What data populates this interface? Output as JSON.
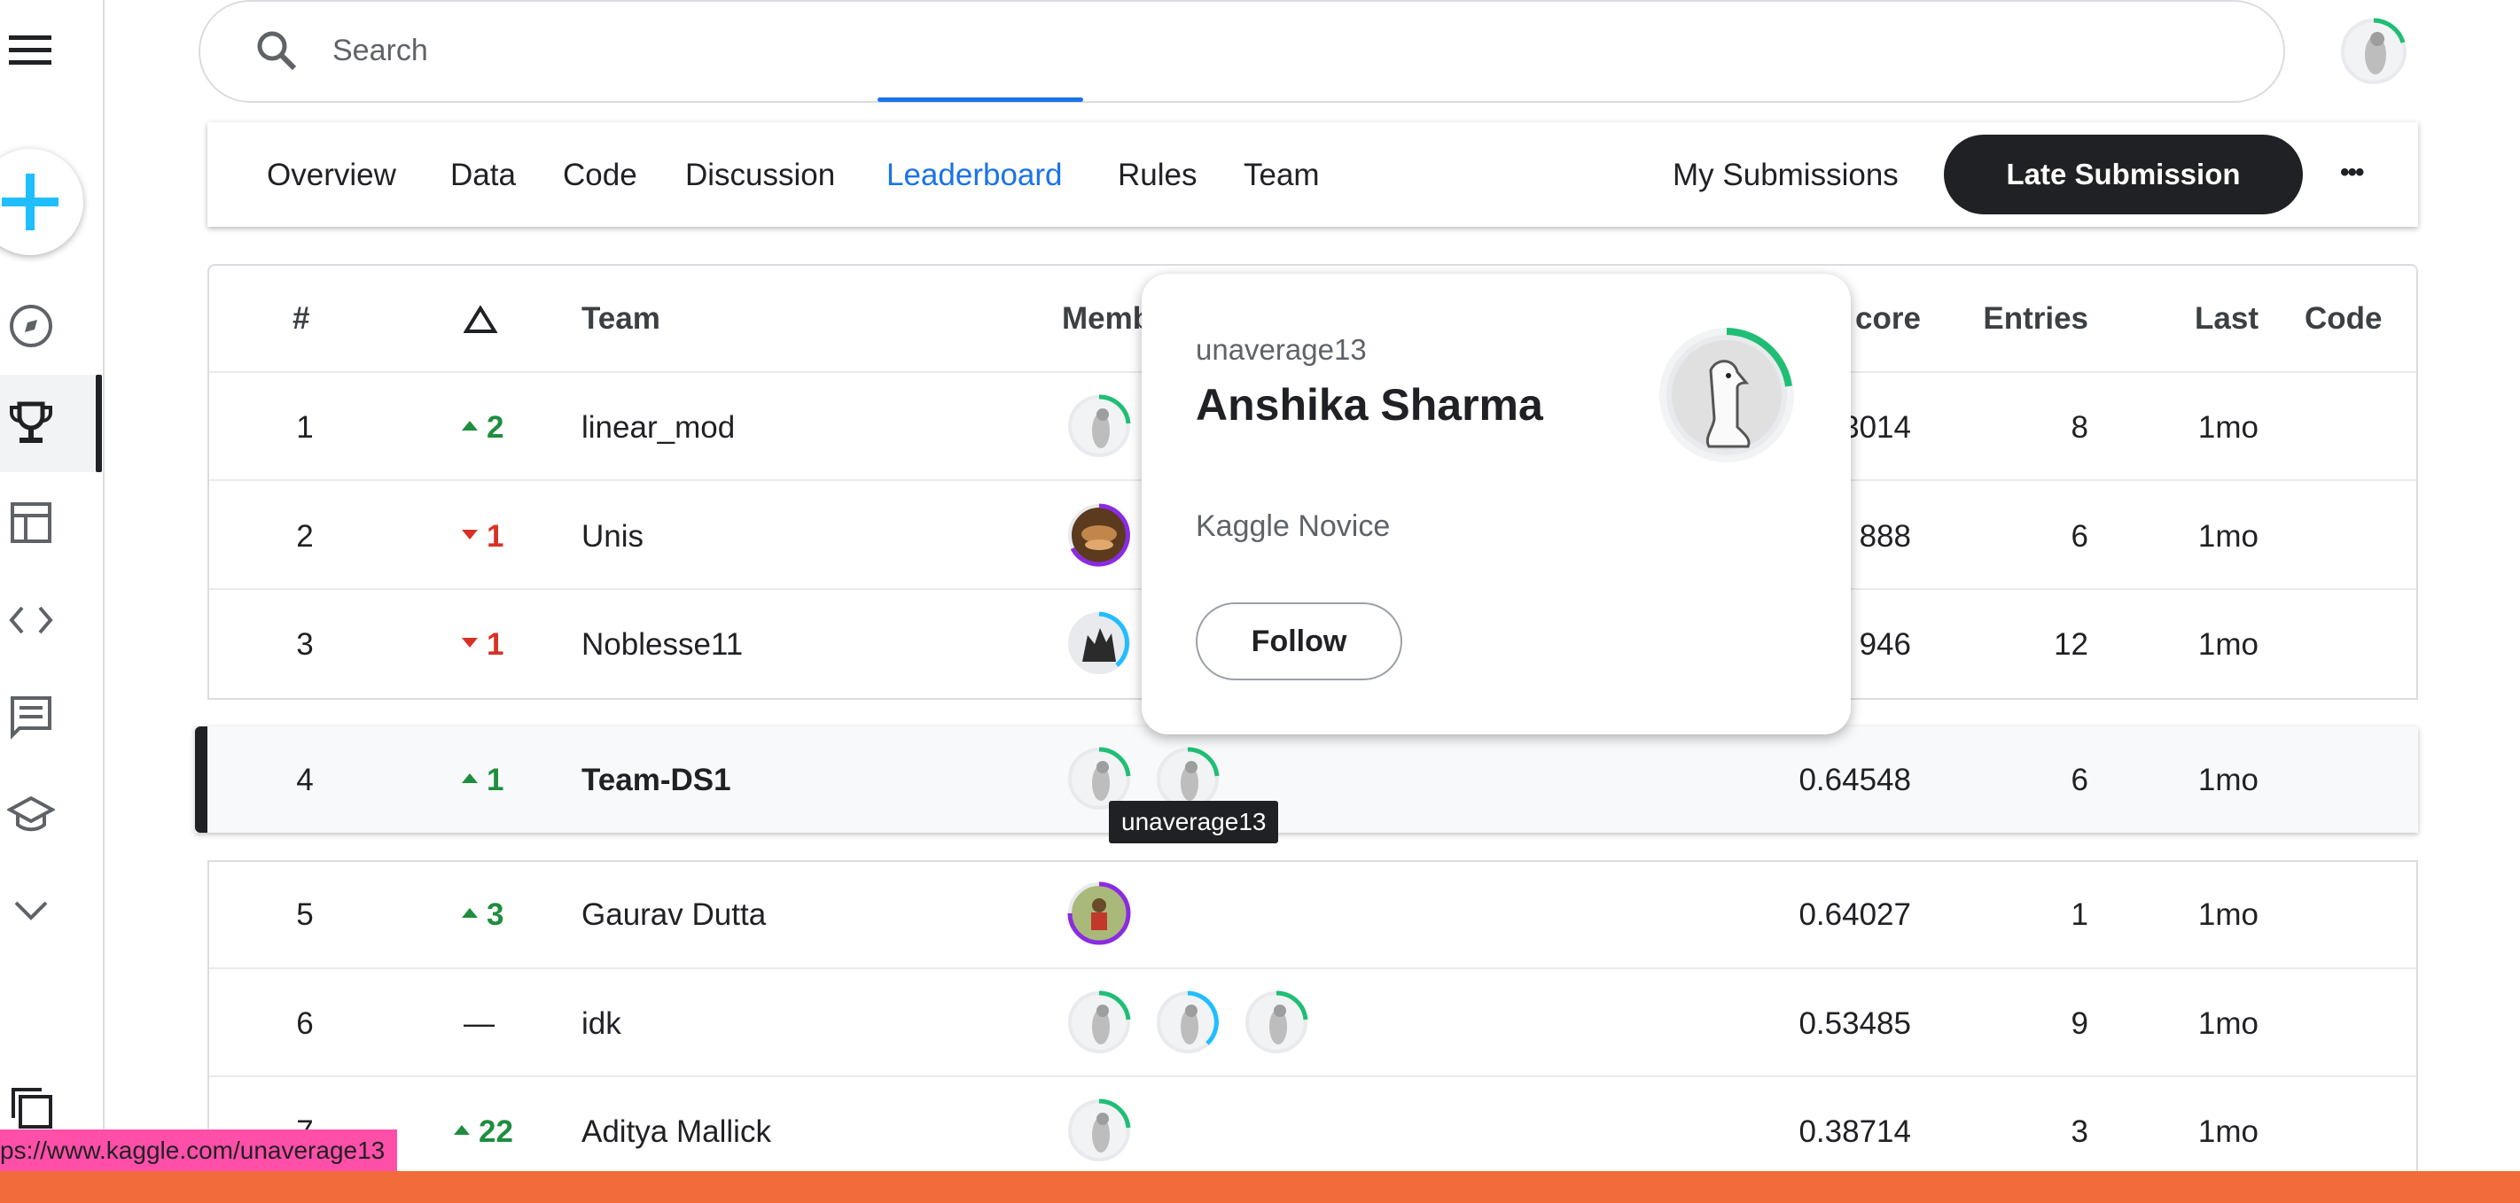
{
  "search": {
    "placeholder": "Search"
  },
  "tabs": [
    {
      "label": "Overview"
    },
    {
      "label": "Data"
    },
    {
      "label": "Code"
    },
    {
      "label": "Discussion"
    },
    {
      "label": "Leaderboard"
    },
    {
      "label": "Rules"
    },
    {
      "label": "Team"
    }
  ],
  "my_submissions": "My Submissions",
  "late_submission": "Late Submission",
  "more_label": "•••",
  "table": {
    "headers": {
      "rank": "#",
      "team": "Team",
      "members": "Memb",
      "score": "Score",
      "score_visible": "core",
      "entries": "Entries",
      "last": "Last",
      "code": "Code"
    },
    "rows": [
      {
        "rank": "1",
        "delta": "2",
        "dir": "up",
        "team": "linear_mod",
        "score": "3014",
        "entries": "8",
        "last": "1mo"
      },
      {
        "rank": "2",
        "delta": "1",
        "dir": "down",
        "team": "Unis",
        "score": "888",
        "entries": "6",
        "last": "1mo"
      },
      {
        "rank": "3",
        "delta": "1",
        "dir": "down",
        "team": "Noblesse11",
        "score": "946",
        "entries": "12",
        "last": "1mo"
      },
      {
        "rank": "4",
        "delta": "1",
        "dir": "up",
        "team": "Team-DS1",
        "score": "0.64548",
        "entries": "6",
        "last": "1mo"
      },
      {
        "rank": "5",
        "delta": "3",
        "dir": "up",
        "team": "Gaurav Dutta",
        "score": "0.64027",
        "entries": "1",
        "last": "1mo"
      },
      {
        "rank": "6",
        "delta": "—",
        "dir": "none",
        "team": "idk",
        "score": "0.53485",
        "entries": "9",
        "last": "1mo"
      },
      {
        "rank": "7",
        "delta": "22",
        "dir": "up",
        "team": "Aditya Mallick",
        "score": "0.38714",
        "entries": "3",
        "last": "1mo"
      }
    ]
  },
  "popup": {
    "username": "unaverage13",
    "name": "Anshika Sharma",
    "tier": "Kaggle Novice",
    "follow": "Follow"
  },
  "tooltip": "unaverage13",
  "status_url": "ps://www.kaggle.com/unaverage13",
  "colors": {
    "accent": "#1a73e8",
    "up": "#1e8e3e",
    "down": "#d93025",
    "novice": "#20be75",
    "status_bar": "#ff4fa8",
    "bottom_bar": "#f26b3a"
  }
}
